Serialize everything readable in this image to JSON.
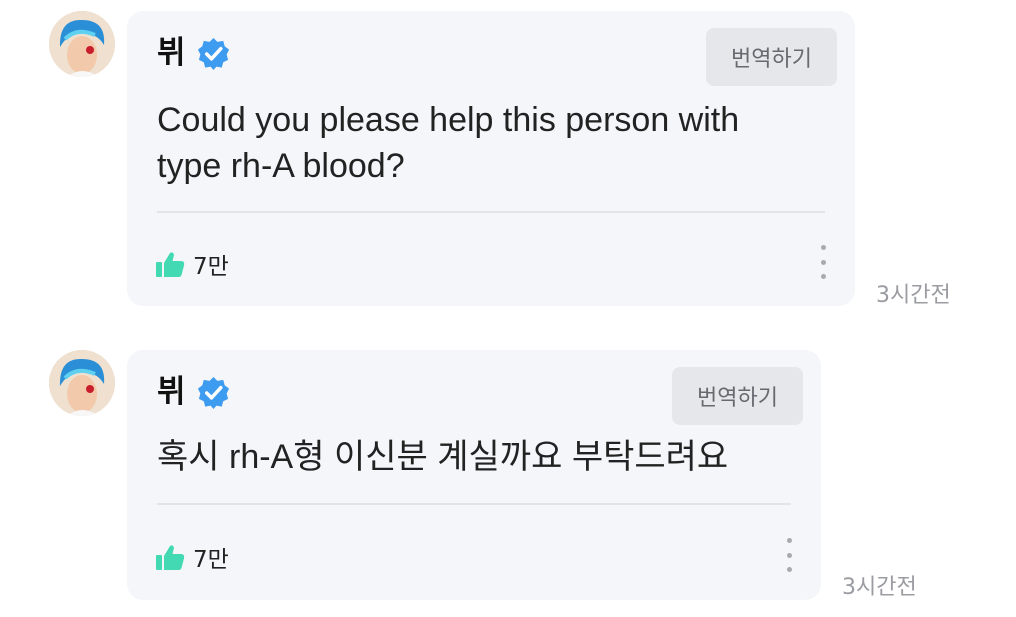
{
  "posts": [
    {
      "author": "뷔",
      "translate_label": "번역하기",
      "message_lines": [
        "Could you please help this person with",
        "type rh-A blood?"
      ],
      "likes": "7만",
      "time": "3시간전"
    },
    {
      "author": "뷔",
      "translate_label": "번역하기",
      "message_lines": [
        "혹시 rh-A형 이신분 계실까요 부탁드려요"
      ],
      "likes": "7만",
      "time": "3시간전"
    }
  ],
  "colors": {
    "card_background": "#f5f6fa",
    "verified_badge": "#3d9bf0",
    "like_icon": "#43d9b3",
    "timestamp": "#9a9ca2"
  },
  "icons": {
    "verified": "verified-badge-icon",
    "like": "thumbs-up-icon",
    "more": "more-vertical-icon"
  }
}
